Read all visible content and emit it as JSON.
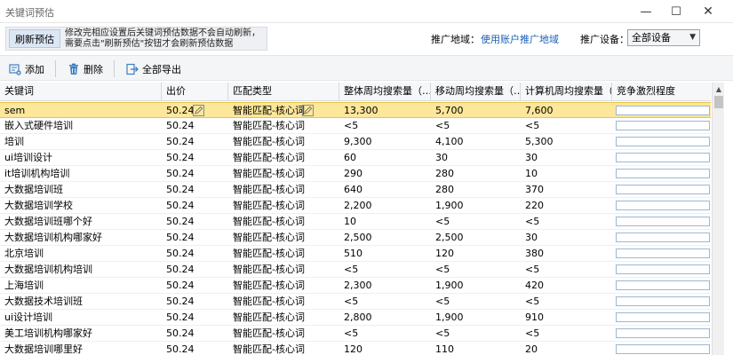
{
  "window": {
    "title": "关键词预估",
    "minimize": "—",
    "maximize": "☐",
    "close": "✕"
  },
  "info": {
    "refresh_label": "刷新预估",
    "notice": "修改完相应设置后关键词预估数据不会自动刷新，需要点击\"刷新预估\"按钮才会刷新预估数据"
  },
  "settings": {
    "region_label": "推广地域：",
    "region_value": "使用账户推广地域",
    "device_label": "推广设备：",
    "device_value": "全部设备"
  },
  "toolbar": {
    "add_label": "添加",
    "delete_label": "删除",
    "export_label": "全部导出"
  },
  "colors": {
    "selected_row": "#fde79a",
    "link": "#1a5fb4",
    "add_icon": "#3f7fc2",
    "delete_icon": "#3f7fc2",
    "export_icon": "#3f7fc2"
  },
  "table": {
    "columns": [
      "关键词",
      "出价",
      "匹配类型",
      "整体周均搜索量（…",
      "移动周均搜索量（…",
      "计算机周均搜索量（…",
      "竞争激烈程度"
    ],
    "rows": [
      {
        "keyword": "sem",
        "bid": "50.24",
        "match": "智能匹配-核心词",
        "total": "13,300",
        "mobile": "5,700",
        "pc": "7,600",
        "competition": 0,
        "selected": true
      },
      {
        "keyword": "嵌入式硬件培训",
        "bid": "50.24",
        "match": "智能匹配-核心词",
        "total": "<5",
        "mobile": "<5",
        "pc": "<5",
        "competition": 0
      },
      {
        "keyword": "培训",
        "bid": "50.24",
        "match": "智能匹配-核心词",
        "total": "9,300",
        "mobile": "4,100",
        "pc": "5,300",
        "competition": 0
      },
      {
        "keyword": "ui培训设计",
        "bid": "50.24",
        "match": "智能匹配-核心词",
        "total": "60",
        "mobile": "30",
        "pc": "30",
        "competition": 0
      },
      {
        "keyword": "it培训机构培训",
        "bid": "50.24",
        "match": "智能匹配-核心词",
        "total": "290",
        "mobile": "280",
        "pc": "10",
        "competition": 0
      },
      {
        "keyword": "大数据培训班",
        "bid": "50.24",
        "match": "智能匹配-核心词",
        "total": "640",
        "mobile": "280",
        "pc": "370",
        "competition": 0
      },
      {
        "keyword": "大数据培训学校",
        "bid": "50.24",
        "match": "智能匹配-核心词",
        "total": "2,200",
        "mobile": "1,900",
        "pc": "220",
        "competition": 0
      },
      {
        "keyword": "大数据培训班哪个好",
        "bid": "50.24",
        "match": "智能匹配-核心词",
        "total": "10",
        "mobile": "<5",
        "pc": "<5",
        "competition": 0
      },
      {
        "keyword": "大数据培训机构哪家好",
        "bid": "50.24",
        "match": "智能匹配-核心词",
        "total": "2,500",
        "mobile": "2,500",
        "pc": "30",
        "competition": 0
      },
      {
        "keyword": "北京培训",
        "bid": "50.24",
        "match": "智能匹配-核心词",
        "total": "510",
        "mobile": "120",
        "pc": "380",
        "competition": 0
      },
      {
        "keyword": "大数据培训机构培训",
        "bid": "50.24",
        "match": "智能匹配-核心词",
        "total": "<5",
        "mobile": "<5",
        "pc": "<5",
        "competition": 0
      },
      {
        "keyword": "上海培训",
        "bid": "50.24",
        "match": "智能匹配-核心词",
        "total": "2,300",
        "mobile": "1,900",
        "pc": "420",
        "competition": 0
      },
      {
        "keyword": "大数据技术培训班",
        "bid": "50.24",
        "match": "智能匹配-核心词",
        "total": "<5",
        "mobile": "<5",
        "pc": "<5",
        "competition": 0
      },
      {
        "keyword": "ui设计培训",
        "bid": "50.24",
        "match": "智能匹配-核心词",
        "total": "2,800",
        "mobile": "1,900",
        "pc": "910",
        "competition": 0
      },
      {
        "keyword": "美工培训机构哪家好",
        "bid": "50.24",
        "match": "智能匹配-核心词",
        "total": "<5",
        "mobile": "<5",
        "pc": "<5",
        "competition": 0
      },
      {
        "keyword": "大数据培训哪里好",
        "bid": "50.24",
        "match": "智能匹配-核心词",
        "total": "120",
        "mobile": "110",
        "pc": "20",
        "competition": 0
      }
    ]
  }
}
